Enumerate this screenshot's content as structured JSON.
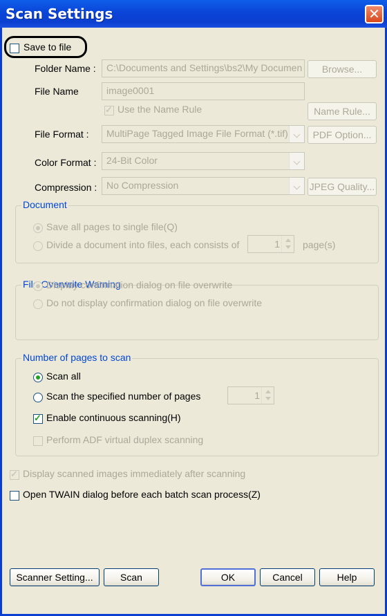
{
  "window": {
    "title": "Scan Settings",
    "close_glyph": "✕"
  },
  "save_to_file": {
    "label": "Save to file",
    "checked": false
  },
  "folder_name": {
    "label": "Folder Name :",
    "value": "C:\\Documents and Settings\\bs2\\My Documen",
    "button": "Browse..."
  },
  "file_name": {
    "label": "File Name",
    "value": "image0001"
  },
  "name_rule": {
    "label": "Use the Name Rule",
    "checked": true,
    "button": "Name Rule..."
  },
  "file_format": {
    "label": "File Format :",
    "value": "MultiPage Tagged Image File Format (*.tif)",
    "button": "PDF Option..."
  },
  "color_format": {
    "label": "Color Format :",
    "value": "24-Bit Color"
  },
  "compression": {
    "label": "Compression :",
    "value": "No Compression",
    "button": "JPEG Quality..."
  },
  "document": {
    "title": "Document",
    "opt_single": "Save all pages to single file(Q)",
    "opt_divide": "Divide a document into files, each consists of",
    "pages_value": "1",
    "pages_unit": "page(s)"
  },
  "overwrite": {
    "title": "File Overwrite Warning",
    "opt_display": "Display confirmation dialog on file overwrite",
    "opt_no_display": "Do not display confirmation dialog on file overwrite"
  },
  "pages_to_scan": {
    "title": "Number of pages to scan",
    "opt_all": "Scan all",
    "opt_specified": "Scan the specified number of pages",
    "count_value": "1",
    "continuous": "Enable continuous scanning(H)",
    "adf_duplex": "Perform ADF virtual duplex scanning"
  },
  "display_images": "Display scanned images immediately after scanning",
  "open_twain": "Open TWAIN dialog before each batch scan process(Z)",
  "buttons": {
    "scanner_setting": "Scanner Setting...",
    "scan": "Scan",
    "ok": "OK",
    "cancel": "Cancel",
    "help": "Help"
  },
  "icons": {
    "check": "check-icon",
    "close": "close-icon",
    "dropdown": "chevron-down-icon"
  }
}
